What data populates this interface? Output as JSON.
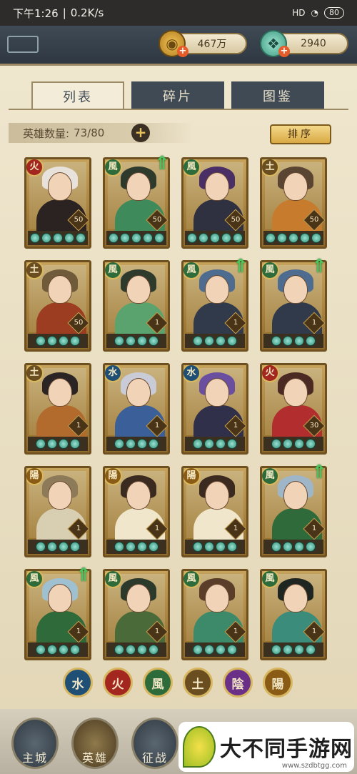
{
  "status_bar": {
    "time": "下午1:26",
    "network": "0.2K/s",
    "signal": "HD",
    "battery": "80"
  },
  "resources": {
    "gold": {
      "value": "467万",
      "icon": "coin-icon"
    },
    "jade": {
      "value": "2940",
      "icon": "jade-icon"
    }
  },
  "tabs": [
    {
      "label": "列表",
      "active": true
    },
    {
      "label": "碎片",
      "active": false
    },
    {
      "label": "图鉴",
      "active": false
    }
  ],
  "hero_count": {
    "label": "英雄数量:",
    "value": "73/80"
  },
  "sort_label": "排序",
  "heroes": [
    {
      "element": "火",
      "level": "50",
      "stars": 5,
      "upgrade": false,
      "hair": "#e8e2dc",
      "robe": "#2b2222"
    },
    {
      "element": "風",
      "level": "50",
      "stars": 5,
      "upgrade": true,
      "hair": "#2d3a2c",
      "robe": "#3f8a5b"
    },
    {
      "element": "風",
      "level": "50",
      "stars": 5,
      "upgrade": false,
      "hair": "#4a2f66",
      "robe": "#2f3040"
    },
    {
      "element": "土",
      "level": "50",
      "stars": 5,
      "upgrade": false,
      "hair": "#5a4533",
      "robe": "#c77b2d"
    },
    {
      "element": "土",
      "level": "50",
      "stars": 4,
      "upgrade": false,
      "hair": "#6f5a3a",
      "robe": "#9c3d22"
    },
    {
      "element": "風",
      "level": "1",
      "stars": 4,
      "upgrade": false,
      "hair": "#2d3a2c",
      "robe": "#5aa36f"
    },
    {
      "element": "風",
      "level": "1",
      "stars": 4,
      "upgrade": true,
      "hair": "#4e6c8f",
      "robe": "#303a4a"
    },
    {
      "element": "風",
      "level": "1",
      "stars": 4,
      "upgrade": true,
      "hair": "#4e6c8f",
      "robe": "#303a4a"
    },
    {
      "element": "土",
      "level": "1",
      "stars": 4,
      "upgrade": false,
      "hair": "#2b2424",
      "robe": "#b36a2d"
    },
    {
      "element": "水",
      "level": "1",
      "stars": 4,
      "upgrade": false,
      "hair": "#c9ccd6",
      "robe": "#3a5f99"
    },
    {
      "element": "水",
      "level": "1",
      "stars": 4,
      "upgrade": false,
      "hair": "#6a4fa1",
      "robe": "#30304a"
    },
    {
      "element": "火",
      "level": "30",
      "stars": 4,
      "upgrade": false,
      "hair": "#4a2a22",
      "robe": "#b22e2e"
    },
    {
      "element": "陽",
      "level": "1",
      "stars": 4,
      "upgrade": false,
      "hair": "#8c7a58",
      "robe": "#d8cfb3"
    },
    {
      "element": "陽",
      "level": "1",
      "stars": 4,
      "upgrade": false,
      "hair": "#3a2a20",
      "robe": "#efe6cc"
    },
    {
      "element": "陽",
      "level": "1",
      "stars": 4,
      "upgrade": false,
      "hair": "#3a2a20",
      "robe": "#efe6cc"
    },
    {
      "element": "風",
      "level": "1",
      "stars": 4,
      "upgrade": true,
      "hair": "#9fb6c8",
      "robe": "#2e6a3a"
    },
    {
      "element": "風",
      "level": "1",
      "stars": 4,
      "upgrade": true,
      "hair": "#9fc0d0",
      "robe": "#2e6a3a"
    },
    {
      "element": "風",
      "level": "1",
      "stars": 4,
      "upgrade": false,
      "hair": "#2b3a2a",
      "robe": "#4a6a3a"
    },
    {
      "element": "風",
      "level": "1",
      "stars": 4,
      "upgrade": false,
      "hair": "#5a3e2a",
      "robe": "#3d8a6b"
    },
    {
      "element": "風",
      "level": "1",
      "stars": 4,
      "upgrade": false,
      "hair": "#1f2622",
      "robe": "#3b8c7a"
    }
  ],
  "element_colors": {
    "火": "#a3261f",
    "風": "#2e6b3a",
    "土": "#6a4e1f",
    "水": "#1f4f74",
    "陽": "#8a5b14",
    "陰": "#6a2f86"
  },
  "element_filters": [
    {
      "label": "水",
      "color": "#1f4f74"
    },
    {
      "label": "火",
      "color": "#a3261f"
    },
    {
      "label": "風",
      "color": "#2e6b3a"
    },
    {
      "label": "土",
      "color": "#6a4e1f"
    },
    {
      "label": "陰",
      "color": "#6a2f86"
    },
    {
      "label": "陽",
      "color": "#8a5b14"
    }
  ],
  "bottom_nav": [
    {
      "label": "主城",
      "active": false
    },
    {
      "label": "英雄",
      "active": true
    },
    {
      "label": "征战",
      "active": false
    }
  ],
  "banner": {
    "text": "大不同手游网",
    "url": "www.szdbtgg.com"
  }
}
